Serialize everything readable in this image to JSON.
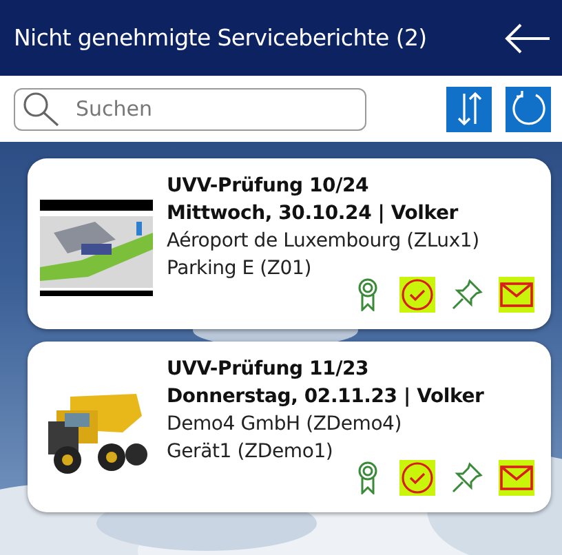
{
  "header": {
    "title": "Nicht genehmigte Serviceberichte (2)"
  },
  "search": {
    "placeholder": "Suchen"
  },
  "reports": [
    {
      "kind": "airport",
      "title": "UVV-Prüfung 10/24",
      "date_line": "Mittwoch, 30.10.24 | Volker",
      "customer": "Aéroport de Luxembourg (ZLux1)",
      "location": "Parking E (Z01)",
      "actions": [
        {
          "kind": "award",
          "highlighted": false
        },
        {
          "kind": "check",
          "highlighted": true
        },
        {
          "kind": "pin",
          "highlighted": false
        },
        {
          "kind": "mail",
          "highlighted": true
        }
      ]
    },
    {
      "kind": "truck",
      "title": "UVV-Prüfung 11/23",
      "date_line": "Donnerstag, 02.11.23 | Volker",
      "customer": "Demo4 GmbH (ZDemo4)",
      "location": "Gerät1 (ZDemo1)",
      "actions": [
        {
          "kind": "award",
          "highlighted": false
        },
        {
          "kind": "check",
          "highlighted": true
        },
        {
          "kind": "pin",
          "highlighted": false
        },
        {
          "kind": "mail",
          "highlighted": true
        }
      ]
    }
  ]
}
